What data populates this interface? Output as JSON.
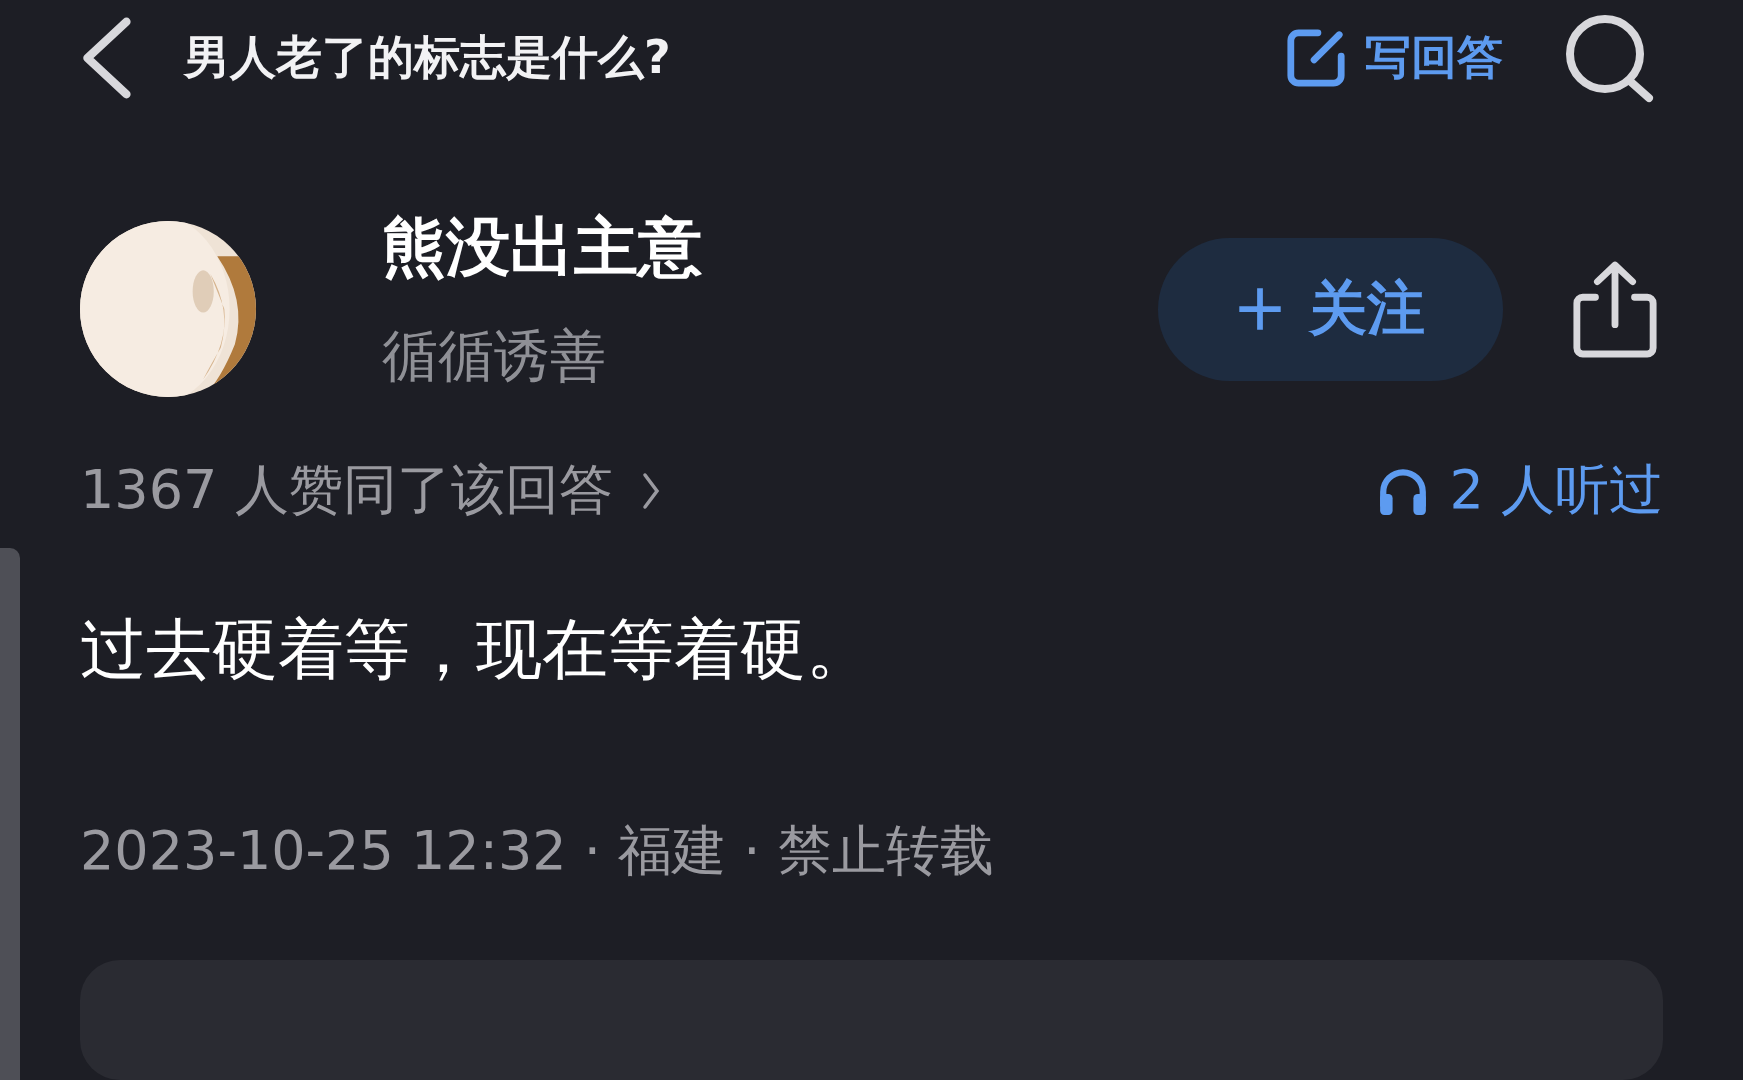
{
  "top_bar": {
    "title": "男人老了的标志是什么?",
    "write_answer": "写回答"
  },
  "author": {
    "name": "熊没出主意",
    "bio": "循循诱善",
    "follow_label": "关注",
    "followed": false
  },
  "stats": {
    "upvotes": "1367 人赞同了该回答",
    "listeners": "2 人听过"
  },
  "answer": {
    "text": "过去硬着等，现在等着硬。",
    "meta": "2023-10-25 12:32 · 福建 · 禁止转载"
  }
}
